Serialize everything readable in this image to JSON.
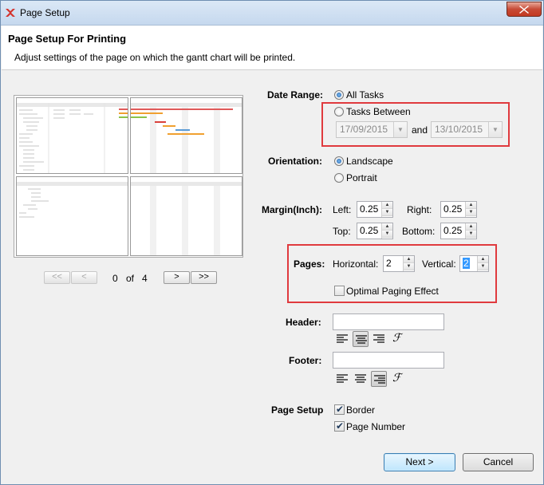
{
  "window": {
    "title": "Page Setup"
  },
  "header": {
    "title": "Page Setup For Printing",
    "subtitle": "Adjust settings of the page on which the gantt chart will be printed."
  },
  "preview": {
    "page_current": "0",
    "page_of": "of",
    "page_total": "4",
    "nav": {
      "first": "<<",
      "prev": "<",
      "next": ">",
      "last": ">>"
    }
  },
  "date_range": {
    "label": "Date Range:",
    "all_tasks": "All Tasks",
    "tasks_between": "Tasks Between",
    "start": "17/09/2015",
    "and": "and",
    "end": "13/10/2015",
    "selected": "All Tasks"
  },
  "orientation": {
    "label": "Orientation:",
    "landscape": "Landscape",
    "portrait": "Portrait",
    "selected": "Landscape"
  },
  "margin": {
    "label": "Margin(Inch):",
    "left_label": "Left:",
    "left": "0.25",
    "right_label": "Right:",
    "right": "0.25",
    "top_label": "Top:",
    "top": "0.25",
    "bottom_label": "Bottom:",
    "bottom": "0.25"
  },
  "pages": {
    "label": "Pages:",
    "horizontal_label": "Horizontal:",
    "horizontal": "2",
    "vertical_label": "Vertical:",
    "vertical": "2",
    "optimal": "Optimal Paging Effect",
    "optimal_checked": false
  },
  "header_field": {
    "label": "Header:",
    "value": ""
  },
  "footer_field": {
    "label": "Footer:",
    "value": ""
  },
  "page_setup": {
    "label": "Page Setup",
    "border": "Border",
    "border_checked": true,
    "page_number": "Page Number",
    "page_number_checked": true
  },
  "buttons": {
    "next": "Next >",
    "cancel": "Cancel"
  },
  "colors": {
    "highlight": "#e03a3e",
    "accent": "#3399ff"
  },
  "icons": [
    "app-icon",
    "close-icon",
    "align-left-icon",
    "align-center-icon",
    "align-right-icon",
    "font-icon"
  ]
}
